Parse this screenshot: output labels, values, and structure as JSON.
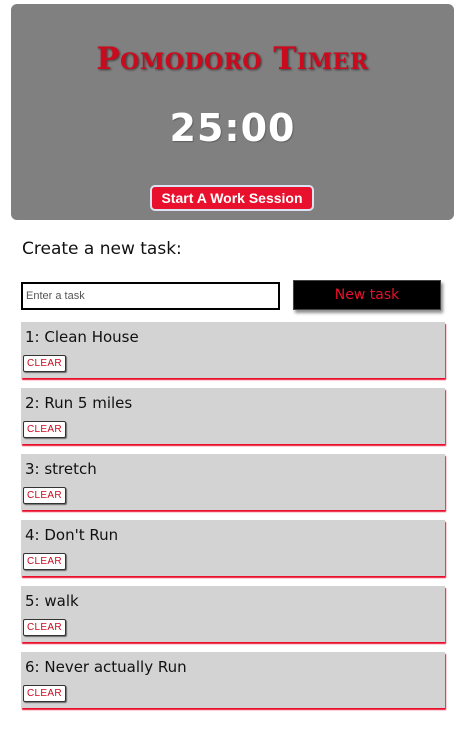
{
  "header": {
    "title": "Pomodoro Timer",
    "timer": "25:00",
    "start_button_label": "Start A Work Session"
  },
  "create": {
    "heading": "Create a new task:",
    "input_placeholder": "Enter a task",
    "input_value": "",
    "button_label": "New task"
  },
  "tasks": [
    {
      "number": "1",
      "text": "1: Clean House",
      "clear_label": "CLEAR"
    },
    {
      "number": "2",
      "text": "2: Run 5 miles",
      "clear_label": "CLEAR"
    },
    {
      "number": "3",
      "text": "3: stretch",
      "clear_label": "CLEAR"
    },
    {
      "number": "4",
      "text": "4: Don't Run",
      "clear_label": "CLEAR"
    },
    {
      "number": "5",
      "text": "5: walk",
      "clear_label": "CLEAR"
    },
    {
      "number": "6",
      "text": "6: Never actually Run",
      "clear_label": "CLEAR"
    }
  ],
  "colors": {
    "accent_red": "#e8102c",
    "panel_gray": "#808080",
    "card_gray": "#d3d3d3"
  }
}
